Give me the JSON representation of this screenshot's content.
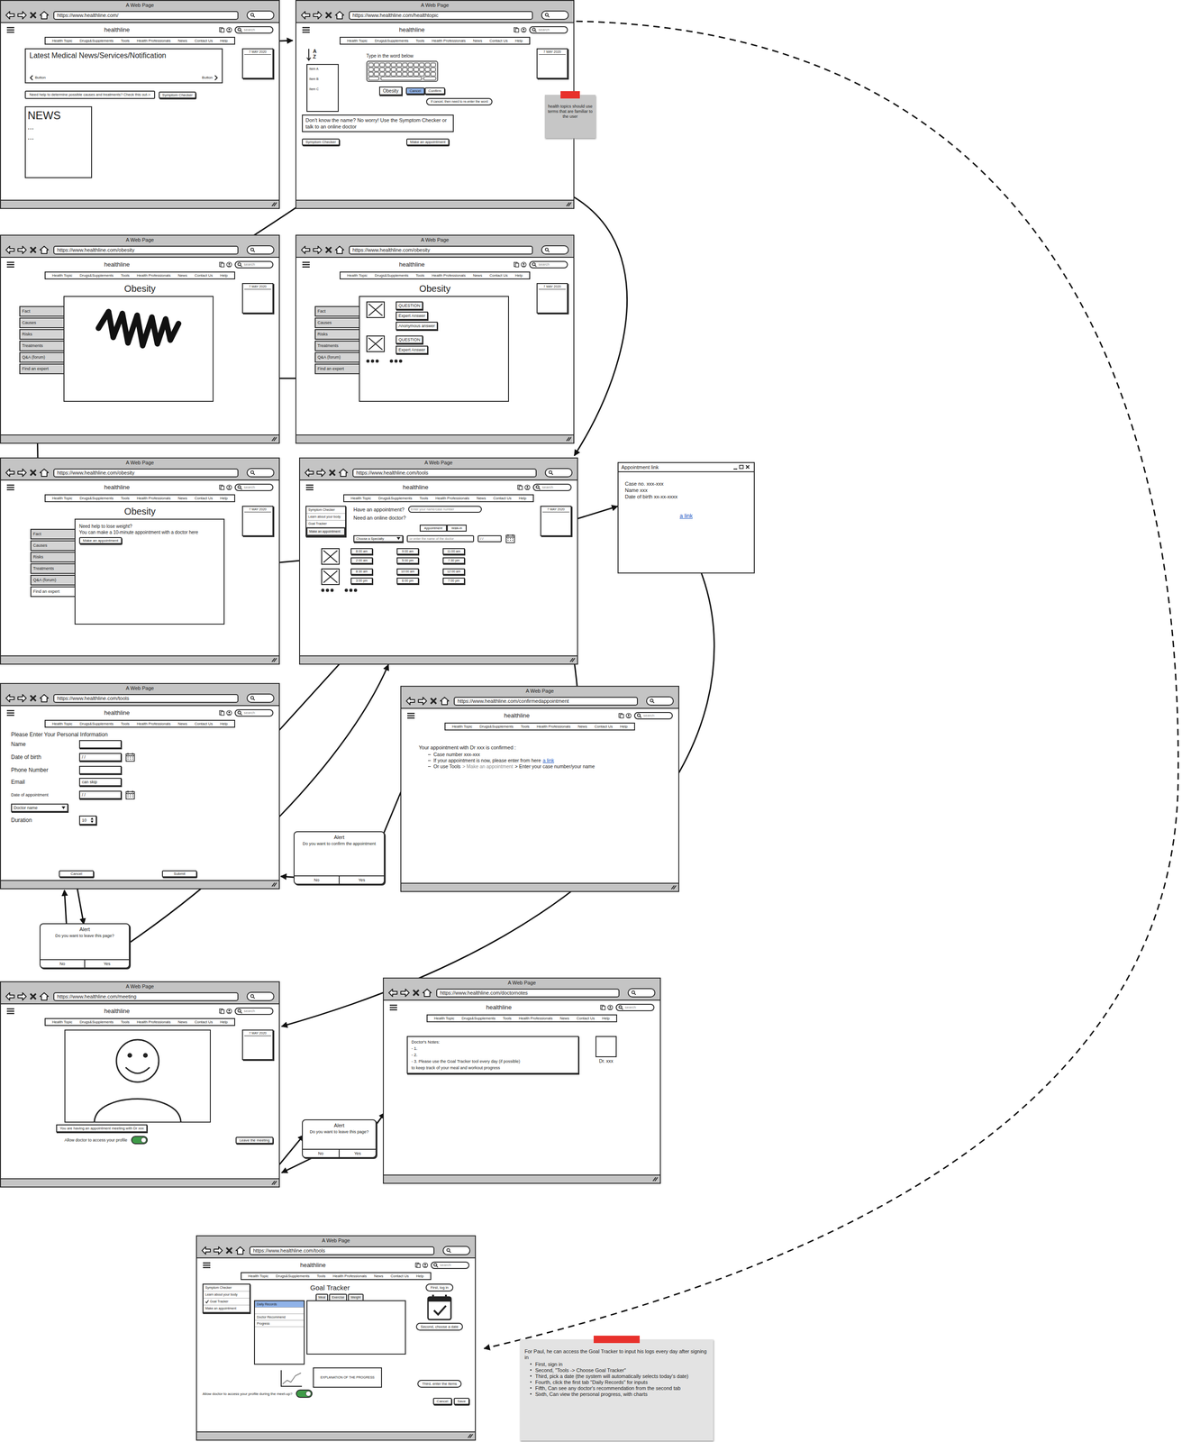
{
  "windows": {
    "home": {
      "title": "A Web Page",
      "url": "https://www.healthline.com/",
      "brand": "healthline",
      "search": "search",
      "nav": [
        "Health Topic",
        "Drugs&Supplements",
        "Tools",
        "Health Professionals",
        "News",
        "Contact Us",
        "Help"
      ],
      "date": "7 MAY 2020",
      "banner": {
        "title": "Latest Medical News/Services/Notification",
        "prev": "Button",
        "next": "Button"
      },
      "prompt": "Need help to determine possible causes and treatments? Check this out->",
      "prompt_button": "Symptom Checker",
      "news": {
        "title": "NEWS",
        "lines": [
          "...",
          "..."
        ]
      }
    },
    "healthtopic": {
      "title": "A Web Page",
      "url": "https://www.healthline.com/healthtopic",
      "brand": "healthline",
      "search": "search",
      "nav": [
        "Health Topic",
        "Drugs&Supplements",
        "Tools",
        "Health Professionals",
        "News",
        "Contact Us",
        "Help"
      ],
      "date": "7 MAY 2020",
      "sort_icon": {
        "top": "A",
        "bottom": "Z"
      },
      "instruction": "Type in the word below",
      "items": [
        "Item A",
        "Item B",
        "Item C"
      ],
      "field": "Obesity",
      "buttons": [
        {
          "label": "Cancel",
          "selected": true
        },
        {
          "label": "Confirm",
          "selected": false
        }
      ],
      "note": "If cancel, then need to re-enter the word",
      "help": "Don't know the name? No worry! Use the Symptom Checker or talk to an online doctor",
      "actions": [
        "Symptom Checker",
        "Make an appointment"
      ]
    },
    "obesity": {
      "title": "A Web Page",
      "url": "https://www.healthline.com/obesity",
      "brand": "healthline",
      "search": "search",
      "nav": [
        "Health Topic",
        "Drugs&Supplements",
        "Tools",
        "Health Professionals",
        "News",
        "Contact Us",
        "Help"
      ],
      "date": "7 MAY 2020",
      "heading": "Obesity",
      "tabs": [
        {
          "label": "Fact",
          "selected": false
        },
        {
          "label": "Causes",
          "selected": false
        },
        {
          "label": "Risks",
          "selected": false
        },
        {
          "label": "Treatments",
          "selected": false
        },
        {
          "label": "Q&A (forum)",
          "selected": false
        },
        {
          "label": "Find an expert",
          "selected": false
        }
      ]
    },
    "forum": {
      "title": "A Web Page",
      "url": "https://www.healthline.com/obesity",
      "brand": "healthline",
      "search": "search",
      "nav": [
        "Health Topic",
        "Drugs&Supplements",
        "Tools",
        "Health Professionals",
        "News",
        "Contact Us",
        "Help"
      ],
      "date": "7 MAY 2020",
      "heading": "Obesity",
      "tabs": [
        {
          "label": "Fact",
          "selected": false
        },
        {
          "label": "Causes",
          "selected": false
        },
        {
          "label": "Risks",
          "selected": false
        },
        {
          "label": "Treatments",
          "selected": false
        },
        {
          "label": "Q&A (forum)",
          "selected": false
        },
        {
          "label": "Find an expert",
          "selected": false
        }
      ],
      "posts": [
        {
          "labels": [
            "QUESTION",
            "Expert Answer",
            "Anonymous answer"
          ]
        },
        {
          "labels": [
            "QUESTION",
            "Expert Answer"
          ]
        }
      ]
    },
    "expert": {
      "title": "A Web Page",
      "url": "https://www.healthline.com/obesity",
      "brand": "healthline",
      "search": "search",
      "nav": [
        "Health Topic",
        "Drugs&Supplements",
        "Tools",
        "Health Professionals",
        "News",
        "Contact Us",
        "Help"
      ],
      "date": "7 MAY 2020",
      "heading": "Obesity",
      "tabs": [
        {
          "label": "Fact",
          "selected": false
        },
        {
          "label": "Causes",
          "selected": false
        },
        {
          "label": "Risks",
          "selected": false
        },
        {
          "label": "Treatments",
          "selected": false
        },
        {
          "label": "Q&A (forum)",
          "selected": false
        },
        {
          "label": "Find an expert",
          "selected": true
        }
      ],
      "question": "Need help to lose weight?",
      "offer": "You can make a 10-minute appointment with a doctor here",
      "button": "Make an appointment"
    },
    "tools": {
      "title": "A Web Page",
      "url": "https://www.healthline.com/tools",
      "brand": "healthline",
      "search": "search",
      "nav": [
        "Health Topic",
        "Drugs&Supplements",
        "Tools",
        "Health Professionals",
        "News",
        "Contact Us",
        "Help"
      ],
      "date": "7 MAY 2020",
      "menu": [
        {
          "label": "Symptom Checker",
          "selected": false
        },
        {
          "label": "Learn about your body",
          "selected": false
        },
        {
          "label": "Goal Tracker",
          "selected": false
        },
        {
          "label": "Make an appointment",
          "selected": true
        }
      ],
      "have_label": "Have an appointment?",
      "have_placeholder": "Enter your name/case number",
      "need_label": "Need an online doctor?",
      "modes": [
        {
          "label": "Appointment",
          "selected": true
        },
        {
          "label": "Walk-in",
          "selected": false
        }
      ],
      "specialty": "Choose a Specialty",
      "doctor_placeholder": "or enter the name of the doctor",
      "date_field": "/ /",
      "doctors": [
        {
          "slots": [
            "8:00 am",
            "9:00 am",
            "11:00 am",
            "2:00 am",
            "5:00 pm",
            "7:30 pm"
          ]
        },
        {
          "slots": [
            "8:30 am",
            "10:00 am",
            "12:00 am",
            "3:00 pm",
            "6:00 pm",
            "7:00 pm"
          ]
        }
      ]
    },
    "popup": {
      "title": "Appointment link",
      "lines": [
        "Case no. xxx-xxx",
        "Name xxx",
        "Date of birth xx-xx-xxxx"
      ],
      "link": "a link"
    },
    "form": {
      "title": "A Web Page",
      "url": "https://www.healthline.com/tools",
      "brand": "healthline",
      "search": "search",
      "nav": [
        "Health Topic",
        "Drugs&Supplements",
        "Tools",
        "Health Professionals",
        "News",
        "Contact Us",
        "Help"
      ],
      "heading": "Please Enter Your Personal Information",
      "fields": [
        {
          "label": "Name",
          "kind": "text"
        },
        {
          "label": "Date of birth",
          "kind": "date",
          "value": "/ /"
        },
        {
          "label": "Phone Number",
          "kind": "text"
        },
        {
          "label": "Email",
          "kind": "text",
          "value": "can skip"
        },
        {
          "label": "Date of appointment",
          "kind": "date",
          "value": "/ /"
        },
        {
          "kind": "select",
          "value": "Doctor name"
        },
        {
          "label": "Duration",
          "kind": "spin",
          "value": "10"
        }
      ],
      "buttons": [
        "Cancel",
        "Submit"
      ]
    },
    "confirm_alert": {
      "title": "Alert",
      "message": "Do you want to confirm the appointment",
      "buttons": [
        "No",
        "Yes"
      ]
    },
    "confirmed": {
      "title": "A Web Page",
      "url": "https://www.healthline.com/confirmedappointment",
      "brand": "healthline",
      "search": "search",
      "nav": [
        "Health Topic",
        "Drugs&Supplements",
        "Tools",
        "Health Professionals",
        "News",
        "Contact Us",
        "Help"
      ],
      "heading": "Your appointment with Dr xxx is confirmed :",
      "bullets": [
        {
          "parts": [
            {
              "text": "Case number xxx-xxx",
              "kind": "plain"
            }
          ]
        },
        {
          "parts": [
            {
              "text": "If your appointment is now, please enter from here",
              "kind": "plain"
            },
            {
              "text": "a link",
              "kind": "link"
            }
          ]
        },
        {
          "parts": [
            {
              "text": "Or use Tools",
              "kind": "plain"
            },
            {
              "text": "> Make an appointment",
              "kind": "muted"
            },
            {
              "text": "> Enter your case number/your name",
              "kind": "plain"
            }
          ]
        }
      ]
    },
    "leave_alert": {
      "title": "Alert",
      "message": "Do you want to leave this page?",
      "buttons": [
        "No",
        "Yes"
      ]
    },
    "meeting": {
      "title": "A Web Page",
      "url": "https://www.healthline.com/meeting",
      "brand": "healthline",
      "search": "search",
      "nav": [
        "Health Topic",
        "Drugs&Supplements",
        "Tools",
        "Health Professionals",
        "News",
        "Contact Us",
        "Help"
      ],
      "date": "7 MAY 2020",
      "caption": "You are having an appointment meeting with Dr xxx",
      "toggle": {
        "label": "Allow doctor to access your profile",
        "on": true
      },
      "button": "Leave the meeting"
    },
    "meeting_alert": {
      "title": "Alert",
      "message": "Do you want to leave this page?",
      "buttons": [
        "No",
        "Yes"
      ]
    },
    "notes": {
      "title": "A Web Page",
      "url": "https://www.healthline.com/doctornotes",
      "brand": "healthline",
      "search": "search",
      "nav": [
        "Health Topic",
        "Drugs&Supplements",
        "Tools",
        "Health Professionals",
        "News",
        "Contact Us",
        "Help"
      ],
      "heading": "Doctor's Notes:",
      "lines": [
        "- 1.",
        "- 2.",
        "- 3. Please use the Goal Tracker tool every day (if possible)",
        "to keep track of your meal and workout progress"
      ],
      "doctor": "Dr. xxx"
    },
    "tracker": {
      "title": "A Web Page",
      "url": "https://www.healthline.com/tools",
      "brand": "healthline",
      "search": "search",
      "nav": [
        "Health Topic",
        "Drugs&Supplements",
        "Tools",
        "Health Professionals",
        "News",
        "Contact Us",
        "Help"
      ],
      "login_hint": "First, log in",
      "menu": [
        {
          "label": "Symptom Checker",
          "checked": false
        },
        {
          "label": "Learn about your body",
          "checked": false
        },
        {
          "label": "Goal Tracker",
          "checked": true
        },
        {
          "label": "Make an appointment",
          "checked": false
        }
      ],
      "heading": "Goal Tracker",
      "sections": [
        {
          "label": "Daily Records",
          "selected": true
        },
        {
          "label": "Doctor Recommend",
          "selected": false
        },
        {
          "label": "Progress",
          "selected": false
        }
      ],
      "tabs": [
        "Meal",
        "Exercise",
        "Weight"
      ],
      "date_hint": "Second, choose a date",
      "items_hint": "Third, enter the items",
      "explanation": "EXPLANATION OF THE PROGRESS",
      "toggle": {
        "label": "Allow doctor to access your profile during the meet-up?",
        "on": true
      },
      "buttons": [
        "Cancel",
        "Save"
      ]
    }
  },
  "sticky": {
    "text": "health topics should use terms that are familiar to the user"
  },
  "paul_note": {
    "title": "For Paul, he can access the Goal Tracker to input his logs every day after signing in",
    "steps": [
      "First, sign in",
      "Second, \"Tools -> Choose Goal Tracker\"",
      "Third, pick a date (the system will automatically selects today's date)",
      "Fourth, click the first tab \"Daily Records\" for inputs",
      "Fifth, Can see any doctor's recommendation from the second tab",
      "Sixth, Can view the personal progress, with charts"
    ]
  }
}
